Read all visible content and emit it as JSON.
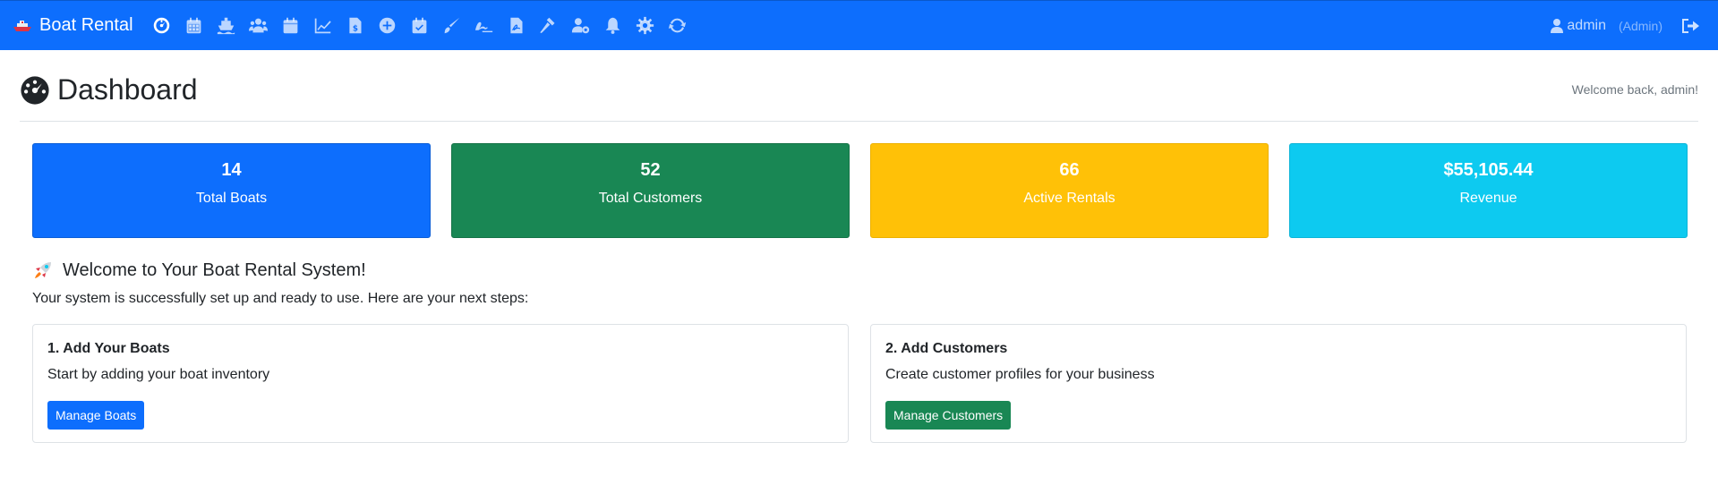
{
  "navbar": {
    "brand": "Boat Rental",
    "icons": [
      "dashboard-icon",
      "calendar-icon",
      "ship-icon",
      "users-icon",
      "calendar-days-icon",
      "chart-line-icon",
      "invoice-icon",
      "plus-circle-icon",
      "calendar-check-icon",
      "paint-brush-icon",
      "signature-icon",
      "file-pdf-icon",
      "gavel-icon",
      "user-cog-icon",
      "bell-icon",
      "gear-icon",
      "sync-icon"
    ],
    "user": {
      "name": "admin",
      "role": "(Admin)"
    },
    "accent": "#0d6efd"
  },
  "header": {
    "title": "Dashboard",
    "welcome": "Welcome back, admin!"
  },
  "stats": [
    {
      "value": "14",
      "label": "Total Boats",
      "color": "#0d6efd"
    },
    {
      "value": "52",
      "label": "Total Customers",
      "color": "#198754"
    },
    {
      "value": "66",
      "label": "Active Rentals",
      "color": "#ffc107"
    },
    {
      "value": "$55,105.44",
      "label": "Revenue",
      "color": "#0dcaf0"
    }
  ],
  "welcome": {
    "heading": "Welcome to Your Boat Rental System!",
    "subtitle": "Your system is successfully set up and ready to use. Here are your next steps:"
  },
  "steps": [
    {
      "title": "1. Add Your Boats",
      "text": "Start by adding your boat inventory",
      "button": "Manage Boats"
    },
    {
      "title": "2. Add Customers",
      "text": "Create customer profiles for your business",
      "button": "Manage Customers"
    }
  ]
}
